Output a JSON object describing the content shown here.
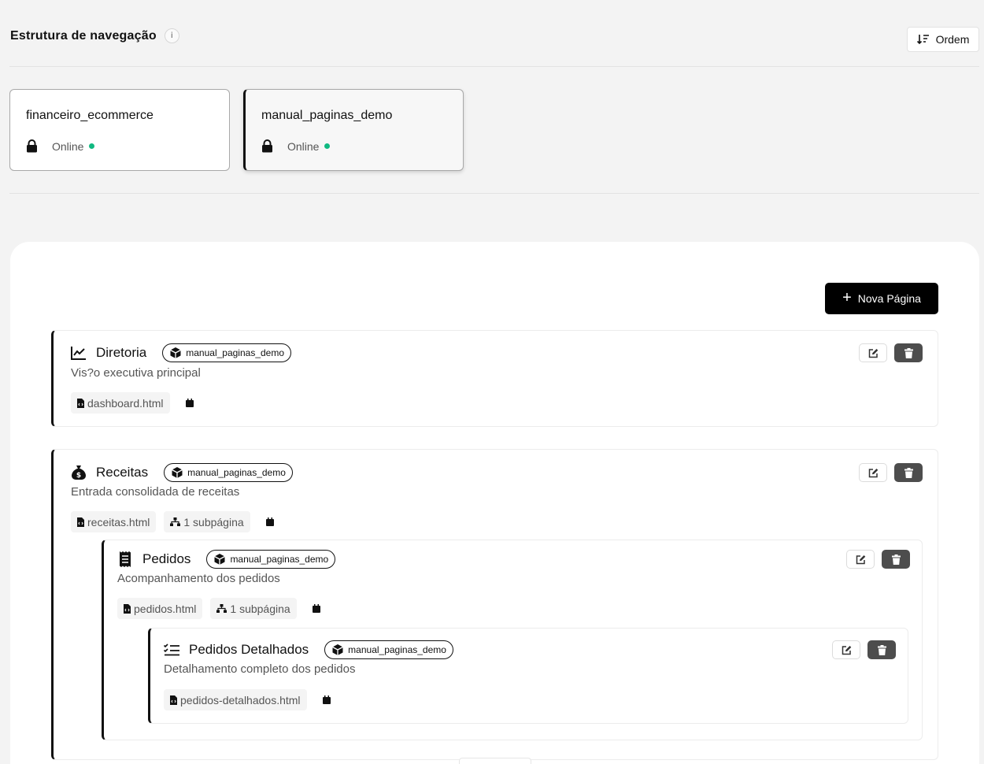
{
  "header": {
    "title": "Estrutura de navegação",
    "info": "i",
    "order_label": "Ordem"
  },
  "databases": [
    {
      "name": "financeiro_ecommerce",
      "status": "Online"
    },
    {
      "name": "manual_paginas_demo",
      "status": "Online"
    }
  ],
  "toolbar": {
    "new_page_label": "Nova Página"
  },
  "pages": [
    {
      "title": "Diretoria",
      "db": "manual_paginas_demo",
      "description": "Vis?o executiva principal",
      "file": "dashboard.html"
    },
    {
      "title": "Receitas",
      "db": "manual_paginas_demo",
      "description": "Entrada consolidada de receitas",
      "file": "receitas.html",
      "subpages": "1 subpágina"
    },
    {
      "title": "Pedidos",
      "db": "manual_paginas_demo",
      "description": "Acompanhamento dos pedidos",
      "file": "pedidos.html",
      "subpages": "1 subpágina"
    },
    {
      "title": "Pedidos Detalhados",
      "db": "manual_paginas_demo",
      "description": "Detalhamento completo dos pedidos",
      "file": "pedidos-detalhados.html"
    }
  ],
  "colors": {
    "accent": "#000000",
    "online": "#10b981",
    "delete": "#4d4d4d"
  }
}
